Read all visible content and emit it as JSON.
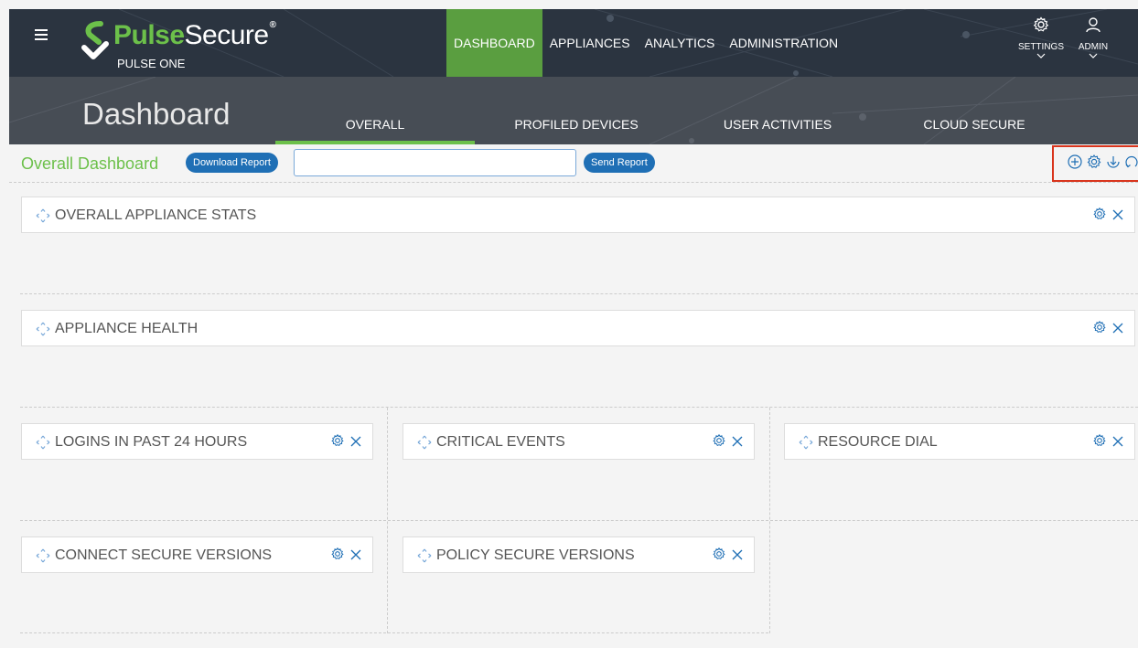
{
  "header": {
    "brand_pulse": "Pulse",
    "brand_secure": "Secure",
    "brand_reg": "®",
    "product": "PULSE ONE",
    "nav": [
      "DASHBOARD",
      "APPLIANCES",
      "ANALYTICS",
      "ADMINISTRATION"
    ],
    "active_nav": "DASHBOARD",
    "settings_label": "SETTINGS",
    "admin_label": "ADMIN"
  },
  "subheader": {
    "title": "Dashboard",
    "tabs": [
      "OVERALL",
      "PROFILED DEVICES",
      "USER ACTIVITIES",
      "CLOUD SECURE"
    ],
    "active_tab": "OVERALL"
  },
  "toolbar": {
    "title": "Overall Dashboard",
    "download_label": "Download Report",
    "send_label": "Send Report",
    "input_value": "",
    "icons": [
      "add-widget-icon",
      "settings-icon",
      "download-icon",
      "refresh-icon"
    ]
  },
  "widgets": [
    "OVERALL APPLIANCE STATS",
    "APPLIANCE HEALTH",
    "LOGINS IN PAST 24 HOURS",
    "CRITICAL EVENTS",
    "RESOURCE DIAL",
    "CONNECT SECURE VERSIONS",
    "POLICY SECURE VERSIONS"
  ],
  "colors": {
    "topbar_bg": "#2b3440",
    "subheader_bg": "#474d55",
    "accent_green": "#6cc04a",
    "active_nav_bg": "#5a9e40",
    "button_blue": "#1f6fb5",
    "highlight_red": "#d9341c"
  }
}
